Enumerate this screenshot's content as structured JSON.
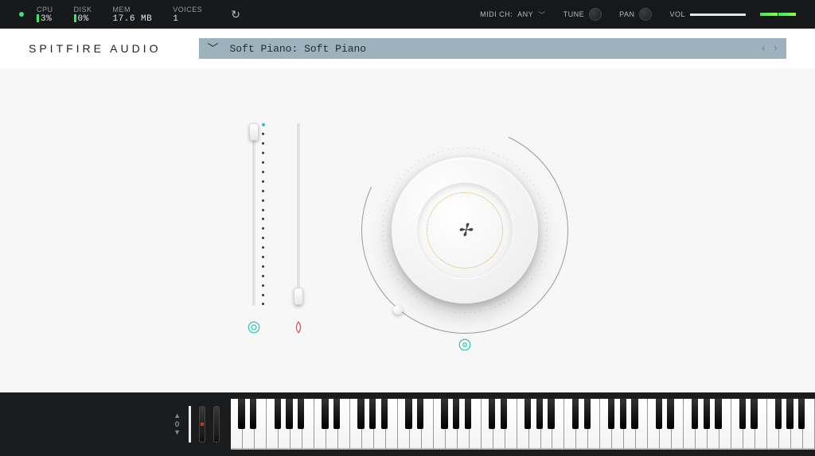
{
  "status": {
    "cpu_label": "CPU",
    "cpu_value": "3%",
    "disk_label": "DISK",
    "disk_value": "0%",
    "mem_label": "MEM",
    "mem_value": "17.6 MB",
    "voices_label": "VOICES",
    "voices_value": "1",
    "midi_label": "MIDI CH:",
    "midi_value": "ANY",
    "tune_label": "TUNE",
    "pan_label": "PAN",
    "vol_label": "VOL"
  },
  "header": {
    "brand": "SPITFIRE AUDIO",
    "preset_name": "Soft Piano: Soft Piano"
  },
  "controls": {
    "slider1": {
      "position_pct": 5,
      "icon_color": "#2ec6b6"
    },
    "slider2": {
      "position_pct": 95,
      "icon_color": "#d65a5a"
    },
    "dial": {
      "value_pct": 0,
      "logo_text": "✢"
    }
  },
  "keyboard": {
    "octave_value": "0",
    "octaves": 7
  },
  "colors": {
    "accent_teal": "#2ec6b6",
    "accent_red": "#d65a5a",
    "preset_bg": "#9eb2be",
    "led_green": "#3be27a"
  }
}
